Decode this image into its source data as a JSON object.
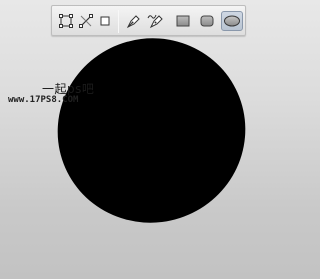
{
  "toolbar": {
    "tools": [
      {
        "icon": "path-transform-icon",
        "selected": false
      },
      {
        "icon": "path-anchor-icon",
        "selected": false
      },
      {
        "icon": "square-outline-icon",
        "selected": false
      },
      {
        "icon": "pen-tool-icon",
        "selected": false
      },
      {
        "icon": "freeform-pen-tool-icon",
        "selected": false
      },
      {
        "icon": "rectangle-tool-icon",
        "selected": false
      },
      {
        "icon": "rounded-rectangle-tool-icon",
        "selected": false
      },
      {
        "icon": "ellipse-tool-icon",
        "selected": true
      }
    ]
  },
  "canvas": {
    "shape": "ellipse",
    "fill_color": "#000000",
    "background_top": "#e8e8e8",
    "background_bottom": "#c2c2c2"
  },
  "watermark": {
    "line1": "一起ps吧",
    "line2": "www.17PS8.COM"
  }
}
